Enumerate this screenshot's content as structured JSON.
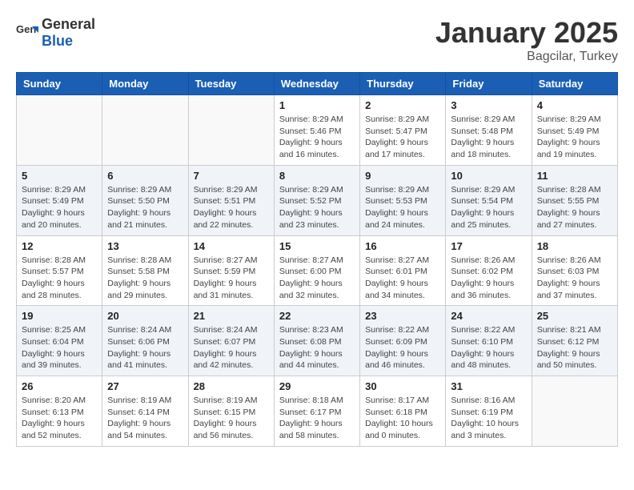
{
  "header": {
    "logo_general": "General",
    "logo_blue": "Blue",
    "title": "January 2025",
    "subtitle": "Bagcilar, Turkey"
  },
  "days_of_week": [
    "Sunday",
    "Monday",
    "Tuesday",
    "Wednesday",
    "Thursday",
    "Friday",
    "Saturday"
  ],
  "weeks": [
    {
      "shaded": false,
      "days": [
        {
          "num": "",
          "info": ""
        },
        {
          "num": "",
          "info": ""
        },
        {
          "num": "",
          "info": ""
        },
        {
          "num": "1",
          "info": "Sunrise: 8:29 AM\nSunset: 5:46 PM\nDaylight: 9 hours and 16 minutes."
        },
        {
          "num": "2",
          "info": "Sunrise: 8:29 AM\nSunset: 5:47 PM\nDaylight: 9 hours and 17 minutes."
        },
        {
          "num": "3",
          "info": "Sunrise: 8:29 AM\nSunset: 5:48 PM\nDaylight: 9 hours and 18 minutes."
        },
        {
          "num": "4",
          "info": "Sunrise: 8:29 AM\nSunset: 5:49 PM\nDaylight: 9 hours and 19 minutes."
        }
      ]
    },
    {
      "shaded": true,
      "days": [
        {
          "num": "5",
          "info": "Sunrise: 8:29 AM\nSunset: 5:49 PM\nDaylight: 9 hours and 20 minutes."
        },
        {
          "num": "6",
          "info": "Sunrise: 8:29 AM\nSunset: 5:50 PM\nDaylight: 9 hours and 21 minutes."
        },
        {
          "num": "7",
          "info": "Sunrise: 8:29 AM\nSunset: 5:51 PM\nDaylight: 9 hours and 22 minutes."
        },
        {
          "num": "8",
          "info": "Sunrise: 8:29 AM\nSunset: 5:52 PM\nDaylight: 9 hours and 23 minutes."
        },
        {
          "num": "9",
          "info": "Sunrise: 8:29 AM\nSunset: 5:53 PM\nDaylight: 9 hours and 24 minutes."
        },
        {
          "num": "10",
          "info": "Sunrise: 8:29 AM\nSunset: 5:54 PM\nDaylight: 9 hours and 25 minutes."
        },
        {
          "num": "11",
          "info": "Sunrise: 8:28 AM\nSunset: 5:55 PM\nDaylight: 9 hours and 27 minutes."
        }
      ]
    },
    {
      "shaded": false,
      "days": [
        {
          "num": "12",
          "info": "Sunrise: 8:28 AM\nSunset: 5:57 PM\nDaylight: 9 hours and 28 minutes."
        },
        {
          "num": "13",
          "info": "Sunrise: 8:28 AM\nSunset: 5:58 PM\nDaylight: 9 hours and 29 minutes."
        },
        {
          "num": "14",
          "info": "Sunrise: 8:27 AM\nSunset: 5:59 PM\nDaylight: 9 hours and 31 minutes."
        },
        {
          "num": "15",
          "info": "Sunrise: 8:27 AM\nSunset: 6:00 PM\nDaylight: 9 hours and 32 minutes."
        },
        {
          "num": "16",
          "info": "Sunrise: 8:27 AM\nSunset: 6:01 PM\nDaylight: 9 hours and 34 minutes."
        },
        {
          "num": "17",
          "info": "Sunrise: 8:26 AM\nSunset: 6:02 PM\nDaylight: 9 hours and 36 minutes."
        },
        {
          "num": "18",
          "info": "Sunrise: 8:26 AM\nSunset: 6:03 PM\nDaylight: 9 hours and 37 minutes."
        }
      ]
    },
    {
      "shaded": true,
      "days": [
        {
          "num": "19",
          "info": "Sunrise: 8:25 AM\nSunset: 6:04 PM\nDaylight: 9 hours and 39 minutes."
        },
        {
          "num": "20",
          "info": "Sunrise: 8:24 AM\nSunset: 6:06 PM\nDaylight: 9 hours and 41 minutes."
        },
        {
          "num": "21",
          "info": "Sunrise: 8:24 AM\nSunset: 6:07 PM\nDaylight: 9 hours and 42 minutes."
        },
        {
          "num": "22",
          "info": "Sunrise: 8:23 AM\nSunset: 6:08 PM\nDaylight: 9 hours and 44 minutes."
        },
        {
          "num": "23",
          "info": "Sunrise: 8:22 AM\nSunset: 6:09 PM\nDaylight: 9 hours and 46 minutes."
        },
        {
          "num": "24",
          "info": "Sunrise: 8:22 AM\nSunset: 6:10 PM\nDaylight: 9 hours and 48 minutes."
        },
        {
          "num": "25",
          "info": "Sunrise: 8:21 AM\nSunset: 6:12 PM\nDaylight: 9 hours and 50 minutes."
        }
      ]
    },
    {
      "shaded": false,
      "days": [
        {
          "num": "26",
          "info": "Sunrise: 8:20 AM\nSunset: 6:13 PM\nDaylight: 9 hours and 52 minutes."
        },
        {
          "num": "27",
          "info": "Sunrise: 8:19 AM\nSunset: 6:14 PM\nDaylight: 9 hours and 54 minutes."
        },
        {
          "num": "28",
          "info": "Sunrise: 8:19 AM\nSunset: 6:15 PM\nDaylight: 9 hours and 56 minutes."
        },
        {
          "num": "29",
          "info": "Sunrise: 8:18 AM\nSunset: 6:17 PM\nDaylight: 9 hours and 58 minutes."
        },
        {
          "num": "30",
          "info": "Sunrise: 8:17 AM\nSunset: 6:18 PM\nDaylight: 10 hours and 0 minutes."
        },
        {
          "num": "31",
          "info": "Sunrise: 8:16 AM\nSunset: 6:19 PM\nDaylight: 10 hours and 3 minutes."
        },
        {
          "num": "",
          "info": ""
        }
      ]
    }
  ]
}
